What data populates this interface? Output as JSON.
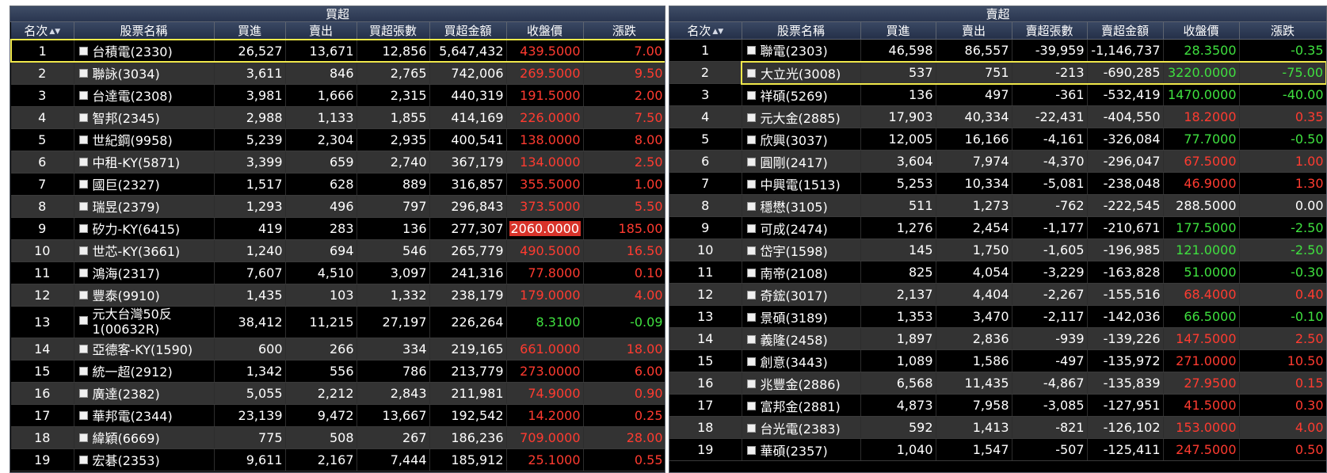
{
  "buy": {
    "title": "買超",
    "headers": [
      "名次",
      "股票名稱",
      "買進",
      "賣出",
      "買超張數",
      "買超金額",
      "收盤價",
      "漲跌"
    ],
    "rows": [
      {
        "rank": "1",
        "name": "台積電(2330)",
        "buy": "26,527",
        "sell": "13,671",
        "net": "12,856",
        "amount": "5,647,432",
        "close": "439.5000",
        "change": "7.00",
        "dir": "up"
      },
      {
        "rank": "2",
        "name": "聯詠(3034)",
        "buy": "3,611",
        "sell": "846",
        "net": "2,765",
        "amount": "742,006",
        "close": "269.5000",
        "change": "9.50",
        "dir": "up"
      },
      {
        "rank": "3",
        "name": "台達電(2308)",
        "buy": "3,981",
        "sell": "1,666",
        "net": "2,315",
        "amount": "440,319",
        "close": "191.5000",
        "change": "2.00",
        "dir": "up"
      },
      {
        "rank": "4",
        "name": "智邦(2345)",
        "buy": "2,988",
        "sell": "1,133",
        "net": "1,855",
        "amount": "414,169",
        "close": "226.0000",
        "change": "7.50",
        "dir": "up"
      },
      {
        "rank": "5",
        "name": "世紀鋼(9958)",
        "buy": "5,239",
        "sell": "2,304",
        "net": "2,935",
        "amount": "400,541",
        "close": "138.0000",
        "change": "8.00",
        "dir": "up"
      },
      {
        "rank": "6",
        "name": "中租-KY(5871)",
        "buy": "3,399",
        "sell": "659",
        "net": "2,740",
        "amount": "367,179",
        "close": "134.0000",
        "change": "2.50",
        "dir": "up"
      },
      {
        "rank": "7",
        "name": "國巨(2327)",
        "buy": "1,517",
        "sell": "628",
        "net": "889",
        "amount": "316,857",
        "close": "355.5000",
        "change": "1.00",
        "dir": "up"
      },
      {
        "rank": "8",
        "name": "瑞昱(2379)",
        "buy": "1,293",
        "sell": "496",
        "net": "797",
        "amount": "296,843",
        "close": "373.5000",
        "change": "5.50",
        "dir": "up"
      },
      {
        "rank": "9",
        "name": "矽力-KY(6415)",
        "buy": "419",
        "sell": "283",
        "net": "136",
        "amount": "277,307",
        "close": "2060.0000",
        "change": "185.00",
        "dir": "limup"
      },
      {
        "rank": "10",
        "name": "世芯-KY(3661)",
        "buy": "1,240",
        "sell": "694",
        "net": "546",
        "amount": "265,779",
        "close": "490.5000",
        "change": "16.50",
        "dir": "up"
      },
      {
        "rank": "11",
        "name": "鴻海(2317)",
        "buy": "7,607",
        "sell": "4,510",
        "net": "3,097",
        "amount": "241,316",
        "close": "77.8000",
        "change": "0.10",
        "dir": "up"
      },
      {
        "rank": "12",
        "name": "豐泰(9910)",
        "buy": "1,435",
        "sell": "103",
        "net": "1,332",
        "amount": "238,179",
        "close": "179.0000",
        "change": "4.00",
        "dir": "up"
      },
      {
        "rank": "13",
        "name": "元大台灣50反1(00632R)",
        "buy": "38,412",
        "sell": "11,215",
        "net": "27,197",
        "amount": "226,264",
        "close": "8.3100",
        "change": "-0.09",
        "dir": "down"
      },
      {
        "rank": "14",
        "name": "亞德客-KY(1590)",
        "buy": "600",
        "sell": "266",
        "net": "334",
        "amount": "219,165",
        "close": "661.0000",
        "change": "18.00",
        "dir": "up"
      },
      {
        "rank": "15",
        "name": "統一超(2912)",
        "buy": "1,342",
        "sell": "556",
        "net": "786",
        "amount": "213,779",
        "close": "273.0000",
        "change": "6.00",
        "dir": "up"
      },
      {
        "rank": "16",
        "name": "廣達(2382)",
        "buy": "5,055",
        "sell": "2,212",
        "net": "2,843",
        "amount": "211,981",
        "close": "74.9000",
        "change": "0.90",
        "dir": "up"
      },
      {
        "rank": "17",
        "name": "華邦電(2344)",
        "buy": "23,139",
        "sell": "9,472",
        "net": "13,667",
        "amount": "192,542",
        "close": "14.2000",
        "change": "0.25",
        "dir": "up"
      },
      {
        "rank": "18",
        "name": "緯穎(6669)",
        "buy": "775",
        "sell": "508",
        "net": "267",
        "amount": "186,236",
        "close": "709.0000",
        "change": "28.00",
        "dir": "up"
      },
      {
        "rank": "19",
        "name": "宏碁(2353)",
        "buy": "9,611",
        "sell": "2,167",
        "net": "7,444",
        "amount": "185,912",
        "close": "25.1000",
        "change": "0.55",
        "dir": "up"
      }
    ]
  },
  "sell": {
    "title": "賣超",
    "headers": [
      "名次",
      "股票名稱",
      "買進",
      "賣出",
      "賣超張數",
      "賣超金額",
      "收盤價",
      "漲跌"
    ],
    "rows": [
      {
        "rank": "1",
        "name": "聯電(2303)",
        "buy": "46,598",
        "sell": "86,557",
        "net": "-39,959",
        "amount": "-1,146,737",
        "close": "28.3500",
        "change": "-0.35",
        "dir": "down"
      },
      {
        "rank": "2",
        "name": "大立光(3008)",
        "buy": "537",
        "sell": "751",
        "net": "-213",
        "amount": "-690,285",
        "close": "3220.0000",
        "change": "-75.00",
        "dir": "down"
      },
      {
        "rank": "3",
        "name": "祥碩(5269)",
        "buy": "136",
        "sell": "497",
        "net": "-361",
        "amount": "-532,419",
        "close": "1470.0000",
        "change": "-40.00",
        "dir": "down"
      },
      {
        "rank": "4",
        "name": "元大金(2885)",
        "buy": "17,903",
        "sell": "40,334",
        "net": "-22,431",
        "amount": "-404,550",
        "close": "18.2000",
        "change": "0.35",
        "dir": "up"
      },
      {
        "rank": "5",
        "name": "欣興(3037)",
        "buy": "12,005",
        "sell": "16,166",
        "net": "-4,161",
        "amount": "-326,084",
        "close": "77.7000",
        "change": "-0.50",
        "dir": "down"
      },
      {
        "rank": "6",
        "name": "圓剛(2417)",
        "buy": "3,604",
        "sell": "7,974",
        "net": "-4,370",
        "amount": "-296,047",
        "close": "67.5000",
        "change": "1.00",
        "dir": "up"
      },
      {
        "rank": "7",
        "name": "中興電(1513)",
        "buy": "5,253",
        "sell": "10,334",
        "net": "-5,081",
        "amount": "-238,048",
        "close": "46.9000",
        "change": "1.30",
        "dir": "up"
      },
      {
        "rank": "8",
        "name": "穩懋(3105)",
        "buy": "511",
        "sell": "1,273",
        "net": "-762",
        "amount": "-222,545",
        "close": "288.5000",
        "change": "0.00",
        "dir": "flat"
      },
      {
        "rank": "9",
        "name": "可成(2474)",
        "buy": "1,276",
        "sell": "2,454",
        "net": "-1,177",
        "amount": "-210,671",
        "close": "177.5000",
        "change": "-2.50",
        "dir": "down"
      },
      {
        "rank": "10",
        "name": "岱宇(1598)",
        "buy": "145",
        "sell": "1,750",
        "net": "-1,605",
        "amount": "-196,985",
        "close": "121.0000",
        "change": "-2.50",
        "dir": "down"
      },
      {
        "rank": "11",
        "name": "南帝(2108)",
        "buy": "825",
        "sell": "4,054",
        "net": "-3,229",
        "amount": "-163,828",
        "close": "51.0000",
        "change": "-0.30",
        "dir": "down"
      },
      {
        "rank": "12",
        "name": "奇鋐(3017)",
        "buy": "2,137",
        "sell": "4,404",
        "net": "-2,267",
        "amount": "-155,516",
        "close": "68.4000",
        "change": "0.40",
        "dir": "up"
      },
      {
        "rank": "13",
        "name": "景碩(3189)",
        "buy": "1,353",
        "sell": "3,470",
        "net": "-2,117",
        "amount": "-142,036",
        "close": "66.5000",
        "change": "-0.10",
        "dir": "down"
      },
      {
        "rank": "14",
        "name": "義隆(2458)",
        "buy": "1,897",
        "sell": "2,836",
        "net": "-939",
        "amount": "-139,226",
        "close": "147.5000",
        "change": "2.50",
        "dir": "up"
      },
      {
        "rank": "15",
        "name": "創意(3443)",
        "buy": "1,089",
        "sell": "1,586",
        "net": "-497",
        "amount": "-135,972",
        "close": "271.0000",
        "change": "10.50",
        "dir": "up"
      },
      {
        "rank": "16",
        "name": "兆豐金(2886)",
        "buy": "6,568",
        "sell": "11,435",
        "net": "-4,867",
        "amount": "-135,839",
        "close": "27.9500",
        "change": "0.15",
        "dir": "up"
      },
      {
        "rank": "17",
        "name": "富邦金(2881)",
        "buy": "4,873",
        "sell": "7,958",
        "net": "-3,085",
        "amount": "-127,951",
        "close": "41.5000",
        "change": "0.30",
        "dir": "up"
      },
      {
        "rank": "18",
        "name": "台光電(2383)",
        "buy": "592",
        "sell": "1,413",
        "net": "-821",
        "amount": "-126,102",
        "close": "153.0000",
        "change": "4.00",
        "dir": "up"
      },
      {
        "rank": "19",
        "name": "華碩(2357)",
        "buy": "1,040",
        "sell": "1,547",
        "net": "-507",
        "amount": "-125,411",
        "close": "247.5000",
        "change": "0.50",
        "dir": "up"
      }
    ]
  },
  "icons": {
    "sort": "sort-arrows-icon",
    "row_checkbox": "checkbox-icon"
  }
}
